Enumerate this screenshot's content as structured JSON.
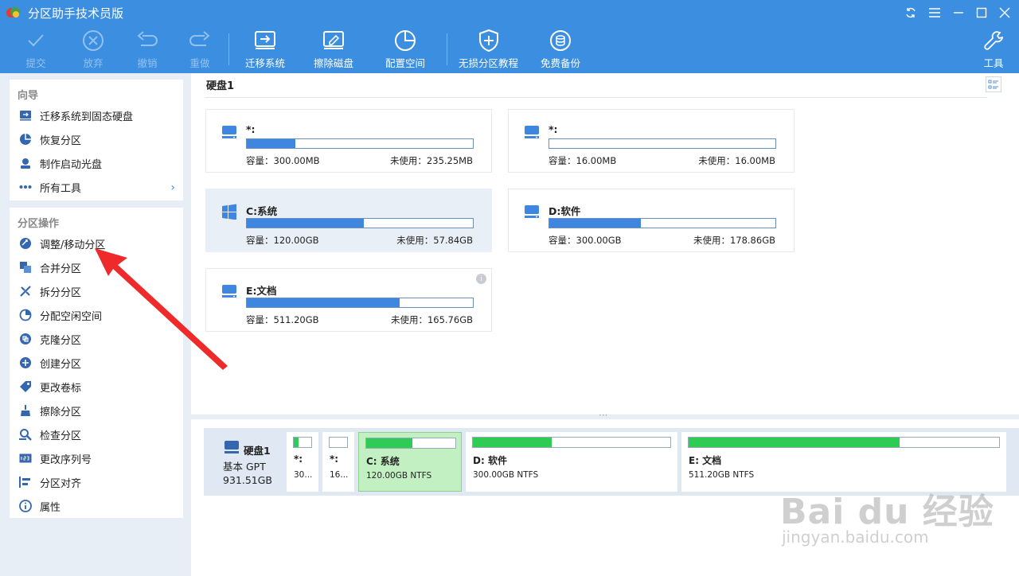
{
  "window": {
    "title": "分区助手技术员版"
  },
  "toolbar": {
    "submit": "提交",
    "discard": "放弃",
    "undo": "撤销",
    "redo": "重做",
    "migrate": "迁移系统",
    "wipe": "擦除磁盘",
    "allocate": "配置空间",
    "tutorial": "无损分区教程",
    "backup": "免费备份",
    "tools": "工具"
  },
  "sidebar": {
    "wizard": {
      "title": "向导",
      "items": [
        {
          "label": "迁移系统到固态硬盘",
          "icon": "migrate-ssd-icon"
        },
        {
          "label": "恢复分区",
          "icon": "recover-partition-icon"
        },
        {
          "label": "制作启动光盘",
          "icon": "boot-disc-icon"
        },
        {
          "label": "所有工具",
          "icon": "more-icon"
        }
      ]
    },
    "ops": {
      "title": "分区操作",
      "items": [
        {
          "label": "调整/移动分区",
          "icon": "resize-icon"
        },
        {
          "label": "合并分区",
          "icon": "merge-icon"
        },
        {
          "label": "拆分分区",
          "icon": "split-icon"
        },
        {
          "label": "分配空闲空间",
          "icon": "allocate-icon"
        },
        {
          "label": "克隆分区",
          "icon": "clone-icon"
        },
        {
          "label": "创建分区",
          "icon": "create-icon"
        },
        {
          "label": "更改卷标",
          "icon": "tag-icon"
        },
        {
          "label": "擦除分区",
          "icon": "wipe-icon"
        },
        {
          "label": "检查分区",
          "icon": "check-icon"
        },
        {
          "label": "更改序列号",
          "icon": "serial-icon"
        },
        {
          "label": "分区对齐",
          "icon": "align-icon"
        },
        {
          "label": "属性",
          "icon": "info-icon"
        }
      ]
    }
  },
  "main": {
    "disk_title": "硬盘1",
    "cards": [
      {
        "name": "*:",
        "cap_label": "容量：300.00MB",
        "free_label": "未使用：235.25MB",
        "used_fraction": 0.216,
        "icon": "drive-icon"
      },
      {
        "name": "*:",
        "cap_label": "容量：16.00MB",
        "free_label": "未使用：16.00MB",
        "used_fraction": 0.0,
        "icon": "drive-icon"
      },
      {
        "name": "C:系统",
        "cap_label": "容量：120.00GB",
        "free_label": "未使用：57.84GB",
        "used_fraction": 0.518,
        "icon": "windows-icon"
      },
      {
        "name": "D:软件",
        "cap_label": "容量：300.00GB",
        "free_label": "未使用：178.86GB",
        "used_fraction": 0.404,
        "icon": "drive-icon"
      },
      {
        "name": "E:文档",
        "cap_label": "容量：511.20GB",
        "free_label": "未使用：165.76GB",
        "used_fraction": 0.676,
        "icon": "drive-icon"
      }
    ]
  },
  "diskmap": {
    "name": "硬盘1",
    "type": "基本 GPT",
    "size": "931.51GB",
    "partitions": [
      {
        "name": "*:",
        "desc": "30...",
        "used_fraction": 0.28
      },
      {
        "name": "*:",
        "desc": "16...",
        "used_fraction": 0.0
      },
      {
        "name": "C: 系统",
        "desc": "120.00GB NTFS",
        "used_fraction": 0.52
      },
      {
        "name": "D: 软件",
        "desc": "300.00GB NTFS",
        "used_fraction": 0.4
      },
      {
        "name": "E: 文档",
        "desc": "511.20GB NTFS",
        "used_fraction": 0.68
      }
    ]
  },
  "watermark": {
    "brand": "Bai du 经验",
    "url": "jingyan.baidu.com"
  },
  "colors": {
    "accent": "#3b8ee0",
    "used_bar": "#3f86e0",
    "map_bar": "#2ecc55",
    "selected": "#e9eff7"
  }
}
